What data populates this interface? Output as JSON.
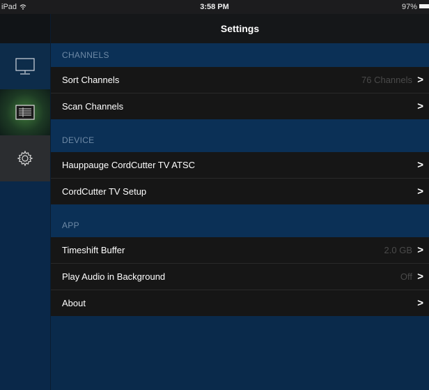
{
  "status_bar": {
    "device": "iPad",
    "time": "3:58 PM",
    "battery": "97%"
  },
  "nav": {
    "title": "Settings"
  },
  "sidebar": {
    "items": [
      {
        "name": "tv",
        "icon": "monitor-icon"
      },
      {
        "name": "guide",
        "icon": "guide-list-icon"
      },
      {
        "name": "settings",
        "icon": "gear-icon",
        "selected": true
      }
    ]
  },
  "sections": [
    {
      "header": "CHANNELS",
      "rows": [
        {
          "label": "Sort Channels",
          "detail": "76 Channels",
          "chevron": ">"
        },
        {
          "label": "Scan Channels",
          "detail": "",
          "chevron": ">"
        }
      ]
    },
    {
      "header": "DEVICE",
      "rows": [
        {
          "label": "Hauppauge CordCutter TV ATSC",
          "detail": "",
          "chevron": ">"
        },
        {
          "label": "CordCutter TV Setup",
          "detail": "",
          "chevron": ">"
        }
      ]
    },
    {
      "header": "APP",
      "rows": [
        {
          "label": "Timeshift Buffer",
          "detail": "2.0 GB",
          "chevron": ">"
        },
        {
          "label": "Play Audio in Background",
          "detail": "Off",
          "chevron": ">"
        },
        {
          "label": "About",
          "detail": "",
          "chevron": ">"
        }
      ]
    }
  ],
  "colors": {
    "background": "#0b2c4f",
    "row_background": "#161616",
    "section_header_text": "#6f8aa6",
    "detail_text": "#4a4a4a"
  }
}
